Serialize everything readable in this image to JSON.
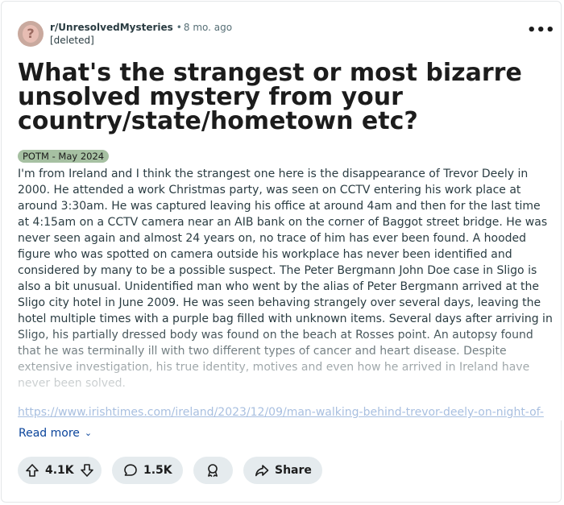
{
  "post": {
    "subreddit": "r/UnresolvedMysteries",
    "separator": "•",
    "age": "8 mo. ago",
    "author": "[deleted]",
    "more_icon": "ellipsis-icon",
    "more_label": "•••",
    "avatar_glyph": "?",
    "title": "What's the strangest or most bizarre unsolved mystery from your country/state/hometown etc?",
    "flair": "POTM - May 2024",
    "body": "I'm from Ireland and I think the strangest one here is the disappearance of Trevor Deely in 2000. He attended a work Christmas party, was seen on CCTV entering his work place at around 3:30am. He was captured leaving his office at around 4am and then for the last time at 4:15am on a CCTV camera near an AIB bank on the corner of Baggot street bridge. He was never seen again and almost 24 years on, no trace of him has ever been found. A hooded figure who was spotted on camera outside his workplace has never been identified and considered by many to be a possible suspect. The Peter Bergmann John Doe case in Sligo is also a bit unusual. Unidentified man who went by the alias of Peter Bergmann arrived at the Sligo city hotel in June 2009. He was seen behaving strangely over several days, leaving the hotel multiple times with a purple bag filled with unknown items. Several days after arriving in Sligo, his partially dressed body was found on the beach at Rosses point. An autopsy found that he was terminally ill with two different types of cancer and heart disease. Despite extensive investigation, his true identity, motives and even how he arrived in Ireland have never been solved.",
    "link": "https://www.irishtimes.com/ireland/2023/12/09/man-walking-behind-trevor-deely-on-night-of-",
    "read_more": "Read more",
    "read_more_chevron": "⌄"
  },
  "actions": {
    "upvotes": "4.1K",
    "comments": "1.5K",
    "share": "Share",
    "icons": {
      "upvote": "upvote-arrow-icon",
      "downvote": "downvote-arrow-icon",
      "comment": "comment-bubble-icon",
      "award": "award-icon",
      "share": "share-arrow-icon"
    }
  },
  "colors": {
    "flair_bg": "#a6c0a2",
    "pill_bg": "#e5ebee",
    "link": "#0a449b",
    "muted": "#576f76"
  }
}
